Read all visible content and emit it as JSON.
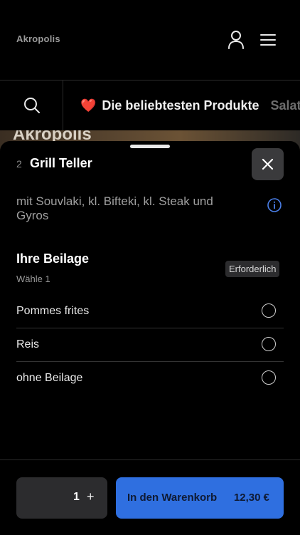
{
  "header": {
    "brand": "Akropolis",
    "user_icon": "user-icon",
    "menu_icon": "menu-icon"
  },
  "categories": {
    "search_icon": "search-icon",
    "items": [
      {
        "label": "Die beliebtesten Produkte",
        "emoji": "❤️",
        "active": true
      },
      {
        "label": "Salat",
        "active": false
      }
    ]
  },
  "background": {
    "peek_title": "Akropolis"
  },
  "product": {
    "count": "2",
    "name": "Grill Teller",
    "description": "mit Souvlaki, kl. Bifteki, kl. Steak und Gyros",
    "info_icon": "info-icon",
    "close_icon": "close-icon"
  },
  "side_section": {
    "title": "Ihre Beilage",
    "subtitle": "Wähle 1",
    "badge": "Erforderlich",
    "options": [
      {
        "label": "Pommes frites",
        "selected": false
      },
      {
        "label": "Reis",
        "selected": false
      },
      {
        "label": "ohne Beilage",
        "selected": false
      }
    ]
  },
  "bottom": {
    "quantity": "1",
    "plus": "+",
    "cart_label": "In den Warenkorb",
    "price": "12,30 €"
  },
  "colors": {
    "accent": "#2f6fe0",
    "info": "#4a7fe8",
    "heart": "#e0323a"
  }
}
